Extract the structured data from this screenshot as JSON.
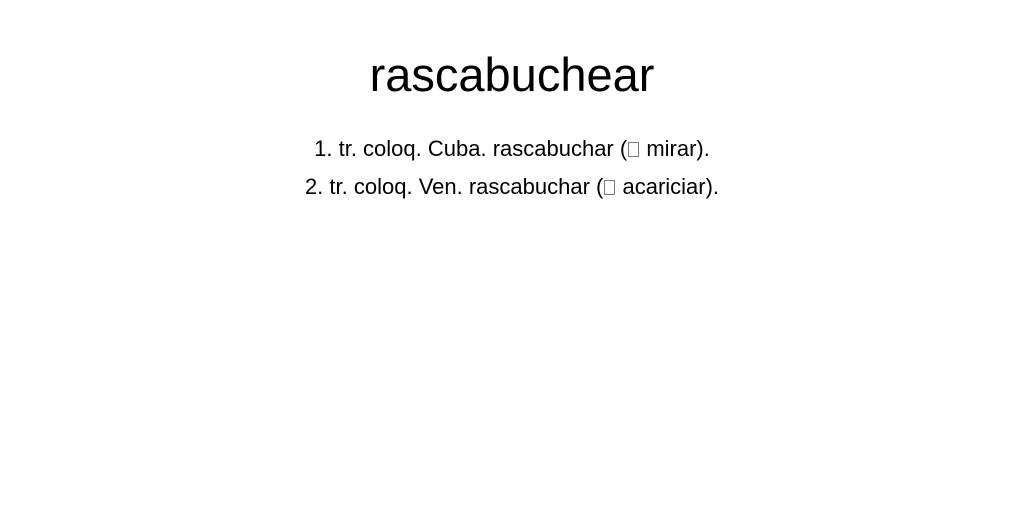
{
  "entry": {
    "headword": "rascabuchear",
    "senses": [
      {
        "number": "1.",
        "text_before": "tr. coloq. Cuba. rascabuchar (",
        "text_after": " mirar)."
      },
      {
        "number": "2.",
        "text_before": "tr. coloq. Ven. rascabuchar (",
        "text_after": " acariciar)."
      }
    ],
    "reference_glyph": "missing-glyph-box-icon"
  }
}
